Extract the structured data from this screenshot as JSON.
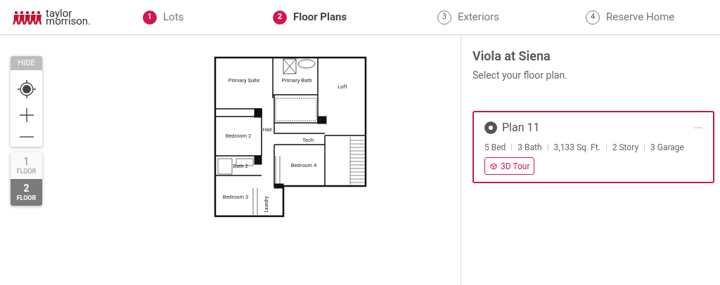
{
  "logo": {
    "line1": "taylor",
    "line2": "morrison."
  },
  "steps": [
    {
      "number": "1",
      "label": "Lots",
      "selected": false
    },
    {
      "number": "2",
      "label": "Floor Plans",
      "selected": true
    },
    {
      "number": "3",
      "label": "Exteriors",
      "selected": false
    },
    {
      "number": "4",
      "label": "Reserve Home",
      "selected": false
    }
  ],
  "map_controls": {
    "hide_label": "HIDE"
  },
  "floors": [
    {
      "number": "1",
      "label": "FLOOR",
      "selected": false
    },
    {
      "number": "2",
      "label": "FLOOR",
      "selected": true
    }
  ],
  "floor_plan": {
    "rooms": [
      "Primary Suite",
      "Primary Bath",
      "Loft",
      "Hall",
      "Bedroom 2",
      "Tech",
      "Bath 2",
      "Bedroom 4",
      "Bedroom 3",
      "Laundry"
    ]
  },
  "community": {
    "title": "Viola at Siena",
    "subtitle": "Select your floor plan."
  },
  "plans": [
    {
      "name": "Plan 11",
      "selected": true,
      "specs": [
        "5 Bed",
        "3 Bath",
        "3,133 Sq. Ft.",
        "2 Story",
        "3 Garage"
      ],
      "tour_label": "3D Tour"
    }
  ]
}
